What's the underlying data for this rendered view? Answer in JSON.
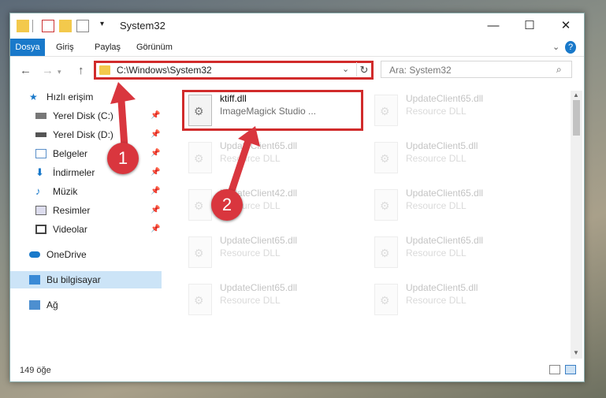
{
  "window": {
    "title": "System32",
    "buttons": {
      "minimize": "—",
      "maximize": "☐",
      "close": "✕"
    }
  },
  "ribbon": {
    "tabs": [
      {
        "label": "Dosya"
      },
      {
        "label": "Giriş"
      },
      {
        "label": "Paylaş"
      },
      {
        "label": "Görünüm"
      }
    ],
    "expand": "⌄",
    "help": "?"
  },
  "nav": {
    "back": "←",
    "forward": "→",
    "up": "↑"
  },
  "address": {
    "path": "C:\\Windows\\System32",
    "dropdown": "⌄",
    "refresh": "↻"
  },
  "search": {
    "placeholder": "Ara: System32",
    "icon": "⌕"
  },
  "sidebar": {
    "items": [
      {
        "label": "Hızlı erişim",
        "icon": "star-icon",
        "pinned": false
      },
      {
        "label": "Yerel Disk (C:)",
        "icon": "drive-icon",
        "pinned": true
      },
      {
        "label": "Yerel Disk (D:)",
        "icon": "drive-icon",
        "pinned": true
      },
      {
        "label": "Belgeler",
        "icon": "document-icon",
        "pinned": true
      },
      {
        "label": "İndirmeler",
        "icon": "download-icon",
        "pinned": true
      },
      {
        "label": "Müzik",
        "icon": "music-icon",
        "pinned": true
      },
      {
        "label": "Resimler",
        "icon": "picture-icon",
        "pinned": true
      },
      {
        "label": "Videolar",
        "icon": "video-icon",
        "pinned": true
      },
      {
        "label": "OneDrive",
        "icon": "cloud-icon"
      },
      {
        "label": "Bu bilgisayar",
        "icon": "computer-icon",
        "selected": true
      },
      {
        "label": "Ağ",
        "icon": "network-icon"
      }
    ],
    "pin_glyph": "📌"
  },
  "files": [
    {
      "name": "ktiff.dll",
      "desc": "ImageMagick Studio ...",
      "highlighted": true
    },
    {
      "name": "UpdateClient65.dll",
      "desc": "Resource DLL"
    },
    {
      "name": "UpdateClient65.dll",
      "desc": "Resource DLL"
    },
    {
      "name": "UpdateClient5.dll",
      "desc": "Resource DLL"
    },
    {
      "name": "UpdateClient42.dll",
      "desc": "Resource DLL"
    },
    {
      "name": "UpdateClient65.dll",
      "desc": "Resource DLL"
    },
    {
      "name": "UpdateClient65.dll",
      "desc": "Resource DLL"
    },
    {
      "name": "UpdateClient65.dll",
      "desc": "Resource DLL"
    },
    {
      "name": "UpdateClient65.dll",
      "desc": "Resource DLL"
    },
    {
      "name": "UpdateClient5.dll",
      "desc": "Resource DLL"
    }
  ],
  "status": {
    "count": "149 öğe"
  },
  "annotations": [
    {
      "label": "1"
    },
    {
      "label": "2"
    }
  ],
  "colors": {
    "accent": "#1979ca",
    "highlight": "#d12b2b",
    "badge": "#d9363e",
    "selected": "#cce4f7"
  }
}
